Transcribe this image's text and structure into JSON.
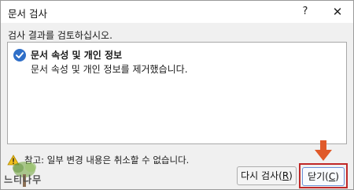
{
  "window": {
    "title": "문서 검사",
    "help_glyph": "?",
    "close_glyph": "✕"
  },
  "heading": "검사 결과를 검토하십시오.",
  "result": {
    "title": "문서 속성 및 개인 정보",
    "description": "문서 속성 및 개인 정보를 제거했습니다."
  },
  "note": "참고: 일부 변경 내용은 취소할 수 없습니다.",
  "buttons": {
    "recheck_label": "다시 검사",
    "recheck_key": "R",
    "close_label": "닫기",
    "close_key": "C"
  },
  "watermark": {
    "text": "느티나무"
  },
  "colors": {
    "accent": "#2f6fc8",
    "highlight": "#c02828",
    "arrow": "#e05a2a"
  }
}
